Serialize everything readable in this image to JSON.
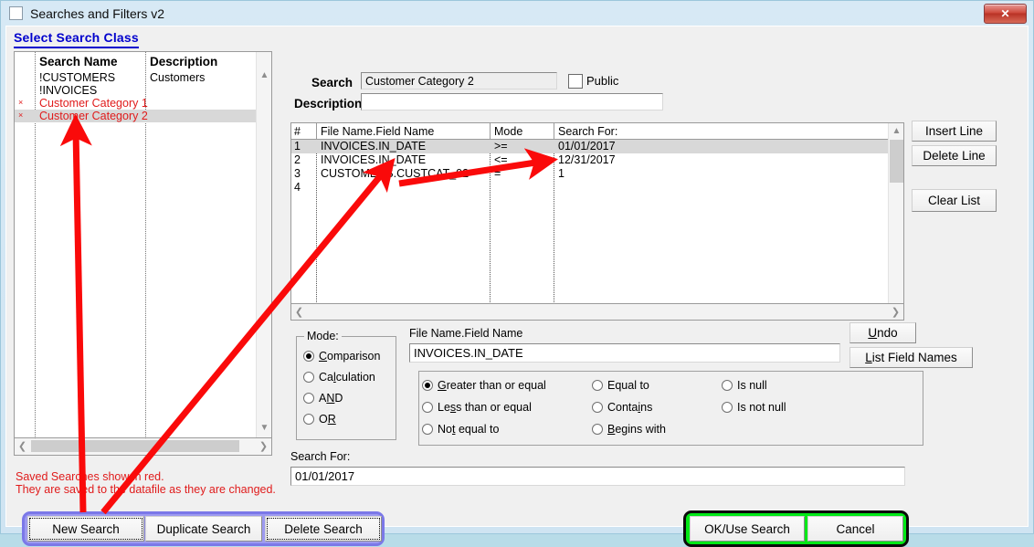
{
  "window": {
    "title": "Searches and Filters v2",
    "close_label": "✕",
    "app_icon": "document-icon"
  },
  "heading": "Select Search Class",
  "search_list": {
    "columns": [
      "Search Name",
      "Description"
    ],
    "rows": [
      {
        "marker": "",
        "name": "!CUSTOMERS",
        "description": "Customers",
        "saved": false,
        "selected": false
      },
      {
        "marker": "",
        "name": "!INVOICES",
        "description": "",
        "saved": false,
        "selected": false
      },
      {
        "marker": "×",
        "name": "Customer Category 1",
        "description": "",
        "saved": true,
        "selected": false
      },
      {
        "marker": "×",
        "name": "Customer Category 2",
        "description": "",
        "saved": true,
        "selected": true
      }
    ]
  },
  "note": {
    "line1": "Saved Searches show in red.",
    "line2": "They are saved to the datafile as they are changed.",
    "color": "#e01b1b"
  },
  "bottom_left_buttons": {
    "new": "New Search",
    "duplicate": "Duplicate Search",
    "delete": "Delete Search"
  },
  "search_header": {
    "search_label": "Search",
    "search_value": "Customer Category 2",
    "description_label": "Description",
    "description_value": "",
    "description_placeholder": "",
    "public_label": "Public",
    "public_checked": false
  },
  "grid": {
    "columns": [
      "#",
      "File Name.Field Name",
      "Mode",
      "Search For:"
    ],
    "rows": [
      {
        "num": "1",
        "field": "INVOICES.IN_DATE",
        "mode": ">=",
        "value": "01/01/2017",
        "selected": true
      },
      {
        "num": "2",
        "field": "INVOICES.IN_DATE",
        "mode": "<=",
        "value": "12/31/2017",
        "selected": false
      },
      {
        "num": "3",
        "field": "CUSTOMERS.CUSTCAT_02",
        "mode": "=",
        "value": "1",
        "selected": false
      },
      {
        "num": "4",
        "field": "",
        "mode": "",
        "value": "",
        "selected": false
      }
    ]
  },
  "line_buttons": {
    "insert": "Insert Line",
    "delete": "Delete Line",
    "clear": "Clear List"
  },
  "mode_group": {
    "legend": "Mode:",
    "options": [
      {
        "label": "Comparison",
        "accel": "C",
        "selected": true
      },
      {
        "label": "Calculation",
        "accel": "l",
        "selected": false
      },
      {
        "label": "AND",
        "accel": "N",
        "selected": false
      },
      {
        "label": "OR",
        "accel": "R",
        "selected": false
      }
    ]
  },
  "field_name": {
    "label": "File Name.Field Name",
    "value": "INVOICES.IN_DATE"
  },
  "operators": {
    "column1": [
      {
        "label": "Greater than or equal",
        "accel": "G",
        "selected": true
      },
      {
        "label": "Less than or equal",
        "accel": "s",
        "selected": false
      },
      {
        "label": "Not equal to",
        "accel": "t",
        "selected": false
      }
    ],
    "column2": [
      {
        "label": "Equal to",
        "accel": "g",
        "selected": false
      },
      {
        "label": "Contains",
        "accel": "i",
        "selected": false
      },
      {
        "label": "Begins with",
        "accel": "B",
        "selected": false
      }
    ],
    "column3": [
      {
        "label": "Is null",
        "accel": "",
        "selected": false
      },
      {
        "label": "Is not null",
        "accel": "",
        "selected": false
      }
    ]
  },
  "side_buttons": {
    "undo": "Undo",
    "list_field_names": "List Field Names"
  },
  "search_for": {
    "label": "Search For:",
    "value": "01/01/2017"
  },
  "dialog_buttons": {
    "ok": "OK/Use Search",
    "cancel": "Cancel"
  },
  "annotations": {
    "arrow_color": "#fa0a0a",
    "highlight_purple": "#9d9af0",
    "highlight_green": "#00e816",
    "arrows": [
      {
        "name": "arrow-to-saved-search-row"
      },
      {
        "name": "arrow-to-grid-field-name"
      },
      {
        "name": "arrow-to-grid-search-for"
      }
    ]
  }
}
